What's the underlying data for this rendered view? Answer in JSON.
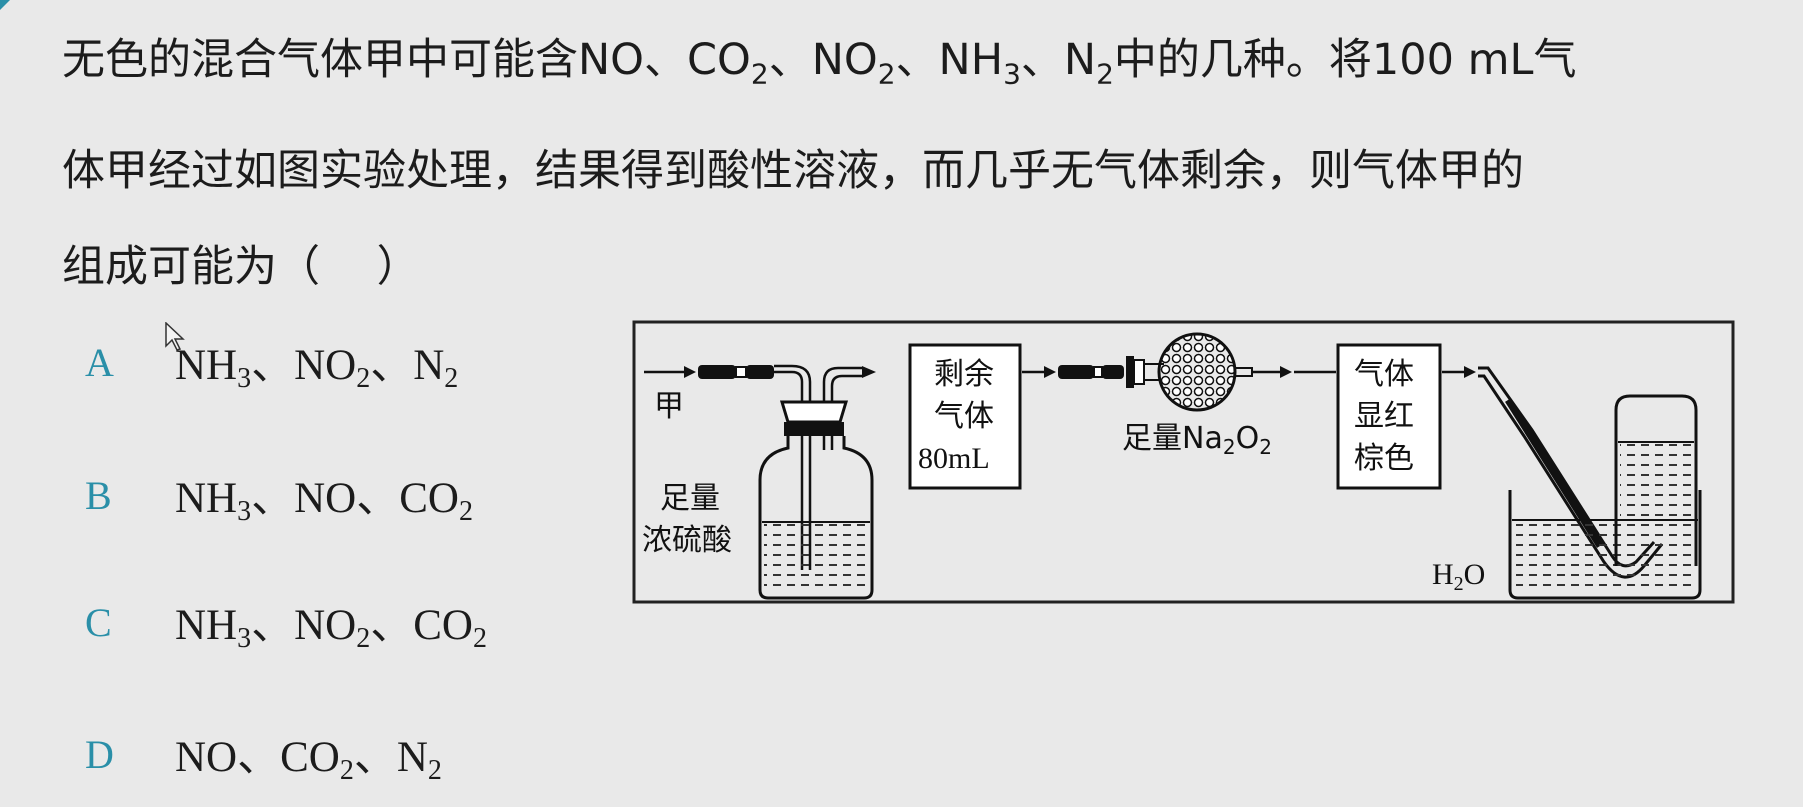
{
  "question": {
    "text_part1": "无色的混合气体甲中可能含NO、CO",
    "text_part2": "、NO",
    "text_part3": "、NH",
    "text_part4": "、N",
    "text_part5": "中的几种。将100 mL气",
    "line2": "体甲经过如图实验处理，结果得到酸性溶液，而几乎无气体剩余，则气体甲的",
    "line3": "组成可能为（　 ）",
    "sub2": "2",
    "sub3": "3"
  },
  "options": [
    {
      "letter": "A",
      "parts": [
        "NH",
        "3",
        "、NO",
        "2",
        "、N",
        "2"
      ]
    },
    {
      "letter": "B",
      "parts": [
        "NH",
        "3",
        "、NO、CO",
        "2"
      ]
    },
    {
      "letter": "C",
      "parts": [
        "NH",
        "3",
        "、NO",
        "2",
        "、CO",
        "2"
      ]
    },
    {
      "letter": "D",
      "parts": [
        "NO、CO",
        "2",
        "、N",
        "2"
      ]
    }
  ],
  "diagram": {
    "input_label": "甲",
    "acid_label_1": "足量",
    "acid_label_2": "浓硫酸",
    "box1_line1": "剩余",
    "box1_line2": "气体",
    "box1_line3": "80mL",
    "na2o2_label_1": "足量Na",
    "na2o2_sub1": "2",
    "na2o2_label_2": "O",
    "na2o2_sub2": "2",
    "box2_line1": "气体",
    "box2_line2": "显红",
    "box2_line3": "棕色",
    "water_label": "H",
    "water_sub": "2",
    "water_label_2": "O"
  },
  "colors": {
    "background": "#e9e9e9",
    "text": "#1c1c1c",
    "option_letter": "#2a8fa8"
  }
}
